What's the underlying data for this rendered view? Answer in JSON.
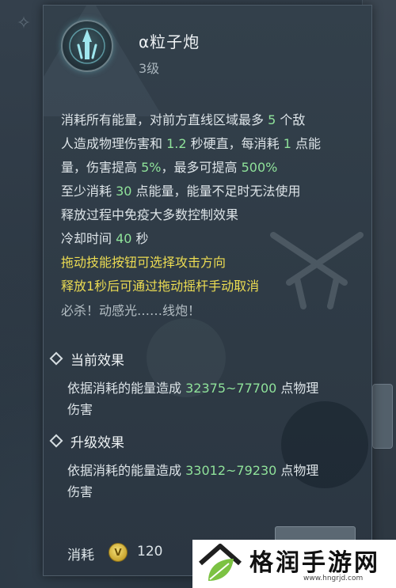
{
  "skill": {
    "name": "α粒子炮",
    "level": "3级",
    "icon": "alpha-cannon-skill-icon"
  },
  "description": {
    "lines": [
      {
        "segments": [
          {
            "text": "消耗所有能量，对前方直线区域最多 ",
            "style": "normal"
          },
          {
            "text": "5",
            "style": "green"
          },
          {
            "text": " 个敌",
            "style": "normal"
          }
        ]
      },
      {
        "segments": [
          {
            "text": "人造成物理伤害和 ",
            "style": "normal"
          },
          {
            "text": "1.2",
            "style": "green"
          },
          {
            "text": " 秒硬直，每消耗 ",
            "style": "normal"
          },
          {
            "text": "1",
            "style": "green"
          },
          {
            "text": " 点能",
            "style": "normal"
          }
        ]
      },
      {
        "segments": [
          {
            "text": "量，伤害提高 ",
            "style": "normal"
          },
          {
            "text": "5%",
            "style": "green"
          },
          {
            "text": "，最多可提高 ",
            "style": "normal"
          },
          {
            "text": "500%",
            "style": "green"
          }
        ]
      },
      {
        "segments": [
          {
            "text": "至少消耗 ",
            "style": "normal"
          },
          {
            "text": "30",
            "style": "green"
          },
          {
            "text": " 点能量，能量不足时无法使用",
            "style": "normal"
          }
        ]
      },
      {
        "segments": [
          {
            "text": "释放过程中免疫大多数控制效果",
            "style": "normal"
          }
        ]
      },
      {
        "segments": [
          {
            "text": "冷却时间 ",
            "style": "normal"
          },
          {
            "text": "40",
            "style": "green"
          },
          {
            "text": " 秒",
            "style": "normal"
          }
        ]
      },
      {
        "segments": [
          {
            "text": "拖动技能按钮可选择攻击方向",
            "style": "yellow"
          }
        ]
      },
      {
        "segments": [
          {
            "text": "释放1秒后可通过拖动摇杆手动取消",
            "style": "yellow"
          }
        ]
      }
    ],
    "quote": "必杀！动感光……线炮！"
  },
  "current_effect": {
    "title": "当前效果",
    "text_prefix": "依据消耗的能量造成 ",
    "value": "32375~77700",
    "text_suffix": " 点物理",
    "text_line2": "伤害"
  },
  "upgrade_effect": {
    "title": "升级效果",
    "text_prefix": "依据消耗的能量造成 ",
    "value": "33012~79230",
    "text_suffix": " 点物理",
    "text_line2": "伤害"
  },
  "cost": {
    "label": "消耗",
    "icon": "coin-icon",
    "icon_glyph": "V",
    "value": "120"
  },
  "watermark": {
    "title": "格润手游网",
    "url": "www.hngrjd.com",
    "logo": "house-leaf-logo"
  },
  "colors": {
    "accent_green": "#8fe29a",
    "accent_yellow": "#ecdc52",
    "panel_bg": "#2e3a45"
  }
}
